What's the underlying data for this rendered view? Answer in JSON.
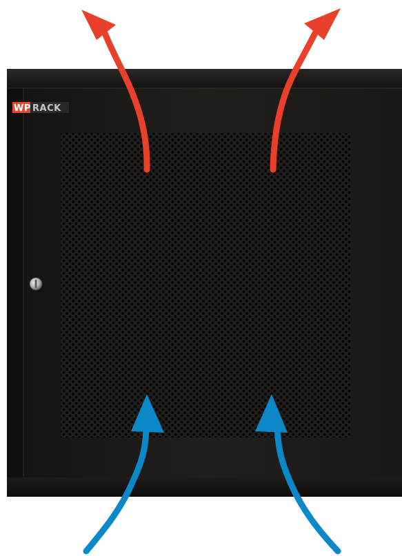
{
  "logo": {
    "prefix": "WP",
    "suffix": "RACK",
    "prefix_color": "#e04a2f",
    "suffix_color": "#c8c8c8"
  },
  "colors": {
    "cabinet_body": "#1c1a18",
    "cabinet_edge": "#0d0c0b",
    "frame_left": "#161412",
    "perforation_hole": "#050505",
    "exhaust_arrow": "#e8402a",
    "intake_arrow": "#0a88c8",
    "lock": "#bdbdbd"
  },
  "icons": {
    "lock": "door-lock-icon",
    "exhaust": "hot-air-out-arrow-icon",
    "intake": "cool-air-in-arrow-icon"
  }
}
